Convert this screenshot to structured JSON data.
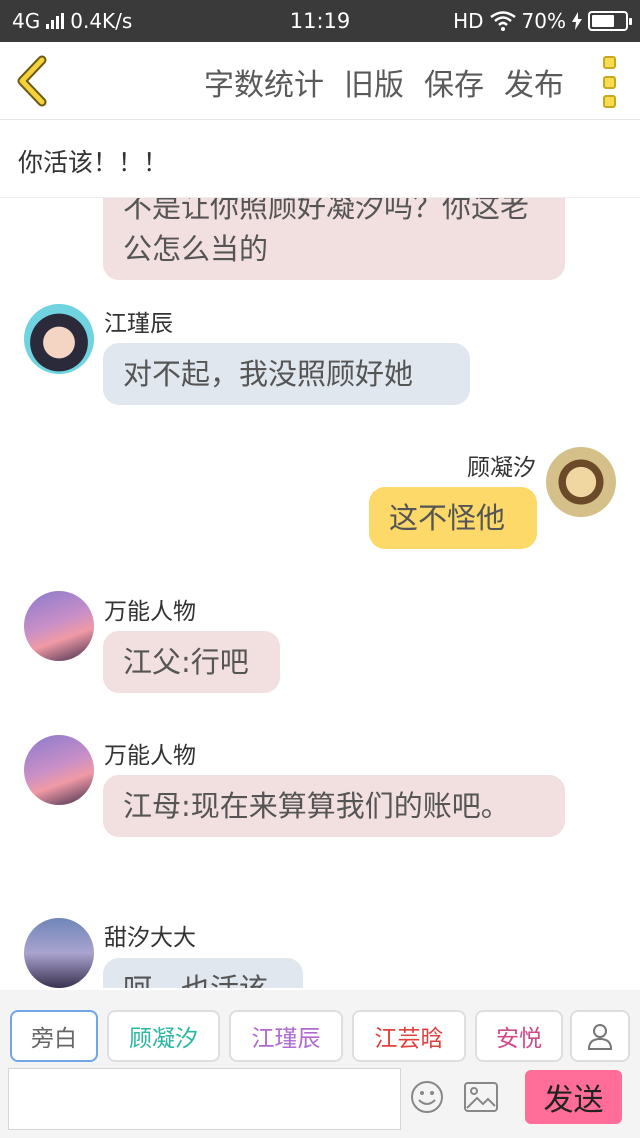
{
  "status_bar": {
    "network": "4G",
    "speed": "0.4K/s",
    "time": "11:19",
    "hd": "HD",
    "battery_percent": "70%",
    "battery_level": 0.7
  },
  "toolbar": {
    "word_count": "字数统计",
    "old_version": "旧版",
    "save": "保存",
    "publish": "发布"
  },
  "story_title": "你活该！！！",
  "messages": [
    {
      "speaker": "",
      "text": "不是让你照顾好凝汐吗？你这老公怎么当的"
    },
    {
      "speaker": "江瑾辰",
      "text": "对不起，我没照顾好她"
    },
    {
      "speaker": "顾凝汐",
      "text": "这不怪他"
    },
    {
      "speaker": "万能人物",
      "text": "江父:行吧"
    },
    {
      "speaker": "万能人物",
      "text": "江母:现在来算算我们的账吧。"
    },
    {
      "speaker": "甜汐大大",
      "text": "呵，也活该"
    }
  ],
  "characters": [
    {
      "label": "旁白",
      "color": "#666666"
    },
    {
      "label": "顾凝汐",
      "color": "#2ab7a0"
    },
    {
      "label": "江瑾辰",
      "color": "#b06ad0"
    },
    {
      "label": "江芸晗",
      "color": "#e0413e"
    },
    {
      "label": "安悦",
      "color": "#d04b8a"
    }
  ],
  "input": {
    "value": "",
    "placeholder": ""
  },
  "send_label": "发送",
  "colors": {
    "accent_yellow": "#fcd968",
    "send_pink": "#ff6d98",
    "bubble_pink": "#f2dfe0",
    "bubble_blue": "#e1e7ee"
  }
}
